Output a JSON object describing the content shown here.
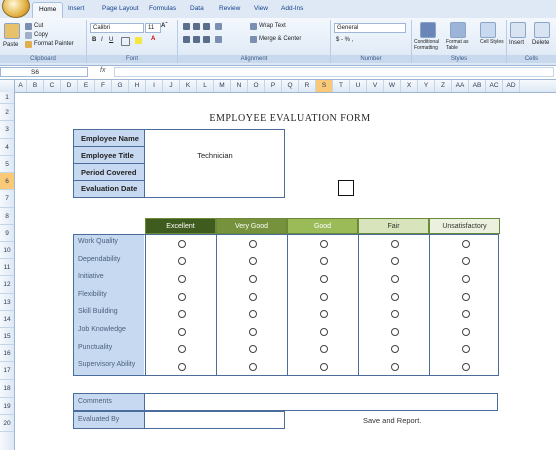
{
  "ribbon": {
    "tabs": [
      "Home",
      "Insert",
      "Page Layout",
      "Formulas",
      "Data",
      "Review",
      "View",
      "Add-Ins"
    ],
    "clipboard": {
      "paste": "Paste",
      "cut": "Cut",
      "copy": "Copy",
      "format_painter": "Format Painter",
      "label": "Clipboard"
    },
    "font": {
      "name": "Calibri",
      "size": "11",
      "label": "Font"
    },
    "alignment": {
      "wrap_text": "Wrap Text",
      "merge_center": "Merge & Center",
      "label": "Alignment"
    },
    "number": {
      "format": "General",
      "symbols": "$ - % ,",
      "label": "Number"
    },
    "styles": {
      "conditional": "Conditional Formatting",
      "format_table": "Format as Table",
      "cell_styles": "Cell Styles",
      "label": "Styles"
    },
    "cells": {
      "insert": "Insert",
      "delete": "Delete",
      "label": "Cells"
    }
  },
  "formula_bar": {
    "name_box": "S6",
    "fx": "fx",
    "value": ""
  },
  "columns": [
    "A",
    "B",
    "C",
    "D",
    "E",
    "F",
    "G",
    "H",
    "I",
    "J",
    "K",
    "L",
    "M",
    "N",
    "O",
    "P",
    "Q",
    "R",
    "S",
    "T",
    "U",
    "V",
    "W",
    "X",
    "Y",
    "Z",
    "AA",
    "AB",
    "AC",
    "AD"
  ],
  "selected_column": "S",
  "rows": [
    "1",
    "2",
    "3",
    "4",
    "5",
    "6",
    "7",
    "8",
    "9",
    "10",
    "11",
    "12",
    "13",
    "14",
    "15",
    "16",
    "17",
    "18",
    "19",
    "20"
  ],
  "selected_row": "6",
  "form": {
    "title": "EMPLOYEE EVALUATION FORM",
    "fields": [
      {
        "label": "Employee Name",
        "value": ""
      },
      {
        "label": "Employee Title",
        "value": "Technician"
      },
      {
        "label": "Period Covered",
        "value": ""
      },
      {
        "label": "Evaluation Date",
        "value": ""
      }
    ],
    "rating_headers": [
      {
        "label": "Excellent",
        "color": "#3f5c1e"
      },
      {
        "label": "Very Good",
        "color": "#76923c"
      },
      {
        "label": "Good",
        "color": "#9bbb59"
      },
      {
        "label": "Fair",
        "color": "#d7e4bc"
      },
      {
        "label": "Unsatisfactory",
        "color": "#ebf1de"
      }
    ],
    "criteria": [
      "Work Quality",
      "Dependability",
      "Initiative",
      "Flexibility",
      "Skill Building",
      "Job Knowledge",
      "Punctuality",
      "Supervisory Ability"
    ],
    "comments_label": "Comments",
    "evaluated_by_label": "Evaluated By",
    "save_text": "Save and Report."
  }
}
